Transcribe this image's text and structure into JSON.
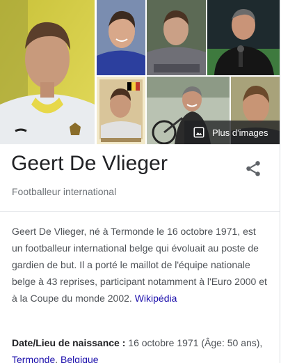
{
  "images": {
    "more_label": "Plus d'images"
  },
  "entity": {
    "name": "Geert De Vlieger",
    "subtitle": "Footballeur international"
  },
  "description": {
    "text": "Geert De Vlieger, né à Termonde le 16 octobre 1971, est un footballeur international belge qui évoluait au poste de gardien de but. Il a porté le maillot de l'équipe nationale belge à 43 reprises, participant notamment à l'Euro 2000 et à la Coupe du monde 2002.",
    "source_link": "Wikipédia"
  },
  "facts": {
    "birth_label": "Date/Lieu de naissance :",
    "birth_value": "16 octobre 1971 (Âge: 50 ans),",
    "birth_place_city": "Termonde",
    "birth_place_separator": ",",
    "birth_place_country": "Belgique"
  },
  "colors": {
    "link": "#1a0dab",
    "muted": "#70757a",
    "text": "#4d5156",
    "overlay": "#202124"
  }
}
